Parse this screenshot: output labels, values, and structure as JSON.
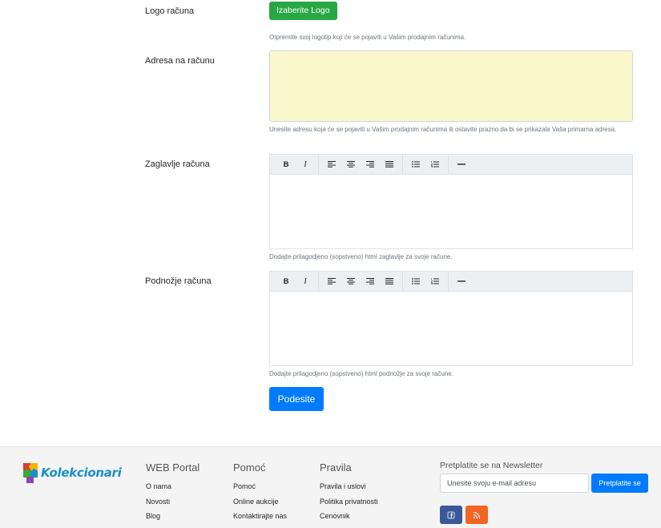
{
  "form": {
    "logo": {
      "label": "Logo računa",
      "button": "Izaberite Logo",
      "help": "Otpremite svoj logotip koji će se pojaviti u Vašim prodajnim računima."
    },
    "address": {
      "label": "Adresa na računu",
      "value": "",
      "help": "Unesite adresu koja će se pojaviti u Vašim prodajnim računima ili ostavite prazno da bi se prikazala Vaša primarna adresa."
    },
    "header": {
      "label": "Zaglavlje računa",
      "help": "Dodajte prilagodjeno (sopstveno) html zaglavlje za svoje račune."
    },
    "footer": {
      "label": "Podnožje računa",
      "help": "Dodajte prilagodjeno (sopstveno) html podnožje za svoje račune."
    },
    "toolbar": {
      "bold": "B",
      "italic": "I",
      "icons": [
        "bold-icon",
        "italic-icon",
        "align-left-icon",
        "align-center-icon",
        "align-right-icon",
        "align-justify-icon",
        "unordered-list-icon",
        "ordered-list-icon",
        "horizontal-rule-icon"
      ]
    },
    "submit": "Podesite"
  },
  "site_footer": {
    "logo_text": "Kolekcionari",
    "columns": [
      {
        "title": "WEB Portal",
        "links": [
          "O nama",
          "Novosti",
          "Blog"
        ]
      },
      {
        "title": "Pomoć",
        "links": [
          "Pomoć",
          "Online aukcije",
          "Kontaktirajte nas"
        ]
      },
      {
        "title": "Pravila",
        "links": [
          "Pravila i uslovi",
          "Politika privatnosti",
          "Cenovnik"
        ]
      }
    ],
    "newsletter": {
      "title": "Pretplatite se na Newsletter",
      "placeholder": "Unesite svoju e-mail adresu",
      "button": "Pretplatite se"
    },
    "social": [
      "facebook-icon",
      "rss-icon"
    ]
  },
  "colors": {
    "green": "#28a745",
    "primary": "#007bff",
    "textarea_bg": "#fbf8cd",
    "facebook": "#3b5998",
    "rss": "#f26522"
  }
}
